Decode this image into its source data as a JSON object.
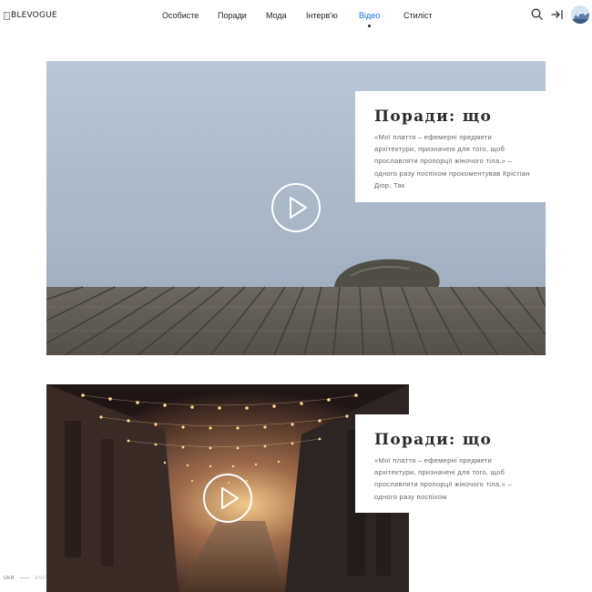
{
  "brand": {
    "logo_text": "BLEVOGUE"
  },
  "nav": {
    "items": [
      {
        "label": "Особисте"
      },
      {
        "label": "Поради"
      },
      {
        "label": "Мода"
      },
      {
        "label": "Інтерв'ю"
      },
      {
        "label": "Відео",
        "active": true
      },
      {
        "label": "Стиліст"
      }
    ]
  },
  "header_icons": [
    "search-icon",
    "login-icon",
    "avatar"
  ],
  "cards": [
    {
      "title": "Поради: що",
      "body": "«Мої плаття – ефемерні предмети архітектури, призначені для того, щоб прославляти пропорції жіночого тіла.» – одного разу поспіхом прокоментував Крістіан Діор. Так"
    },
    {
      "title": "Поради: що",
      "body": "«Мої плаття – ефемерні предмети архітектури, призначені для того, щоб прославляти пропорції жіночого тіла.» – одного разу поспіхом"
    }
  ],
  "footer": {
    "mark": "UKR",
    "dim": "ENG"
  },
  "colors": {
    "accent": "#1a6fd6",
    "text": "#222222",
    "muted": "#666666"
  }
}
